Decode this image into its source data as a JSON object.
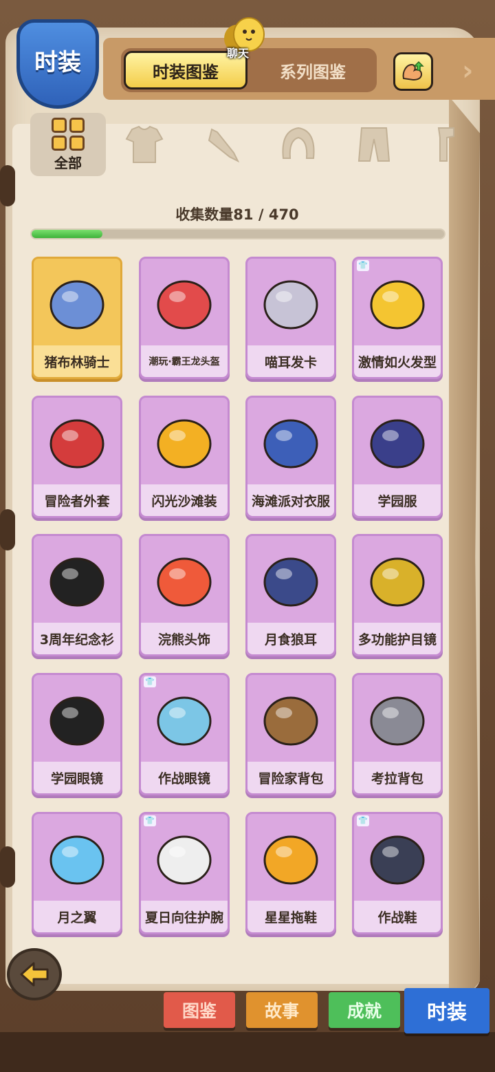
{
  "header": {
    "badge_label": "时装",
    "tabs": [
      {
        "label": "时装图鉴",
        "active": true
      },
      {
        "label": "系列图鉴",
        "active": false
      }
    ],
    "chat_label": "聊天"
  },
  "categories": [
    {
      "label": "全部",
      "icon": "grid-icon",
      "active": true
    },
    {
      "label": "",
      "icon": "top-clothes-icon"
    },
    {
      "label": "",
      "icon": "weapon-icon"
    },
    {
      "label": "",
      "icon": "hair-icon"
    },
    {
      "label": "",
      "icon": "pants-icon"
    },
    {
      "label": "",
      "icon": "accessory-icon"
    }
  ],
  "progress": {
    "label": "收集数量81 / 470",
    "collected": 81,
    "total": 470,
    "fraction": 0.172
  },
  "items": [
    {
      "name": "猪布林骑士",
      "rarity": "gold",
      "badge": false
    },
    {
      "name": "潮玩·霸王龙头盔",
      "rarity": "purple",
      "badge": false
    },
    {
      "name": "喵耳发卡",
      "rarity": "purple",
      "badge": false
    },
    {
      "name": "激情如火发型",
      "rarity": "purple",
      "badge": true
    },
    {
      "name": "冒险者外套",
      "rarity": "purple",
      "badge": false
    },
    {
      "name": "闪光沙滩装",
      "rarity": "purple",
      "badge": false
    },
    {
      "name": "海滩派对衣服",
      "rarity": "purple",
      "badge": false
    },
    {
      "name": "学园服",
      "rarity": "purple",
      "badge": false
    },
    {
      "name": "3周年纪念衫",
      "rarity": "purple",
      "badge": false
    },
    {
      "name": "浣熊头饰",
      "rarity": "purple",
      "badge": false
    },
    {
      "name": "月食狼耳",
      "rarity": "purple",
      "badge": false
    },
    {
      "name": "多功能护目镜",
      "rarity": "purple",
      "badge": false
    },
    {
      "name": "学园眼镜",
      "rarity": "purple",
      "badge": false
    },
    {
      "name": "作战眼镜",
      "rarity": "purple",
      "badge": true
    },
    {
      "name": "冒险家背包",
      "rarity": "purple",
      "badge": false
    },
    {
      "name": "考拉背包",
      "rarity": "purple",
      "badge": false
    },
    {
      "name": "月之翼",
      "rarity": "purple",
      "badge": false
    },
    {
      "name": "夏日向往护腕",
      "rarity": "purple",
      "badge": true
    },
    {
      "name": "星星拖鞋",
      "rarity": "purple",
      "badge": false
    },
    {
      "name": "作战鞋",
      "rarity": "purple",
      "badge": true
    }
  ],
  "bottom_tabs": [
    {
      "label": "图鉴"
    },
    {
      "label": "故事"
    },
    {
      "label": "成就"
    },
    {
      "label": "时装",
      "active": true
    }
  ],
  "colors": {
    "card_purple": "#dba8e0",
    "card_gold": "#f3c65a",
    "progress_green": "#3fb23a",
    "tab_gold": "#f3cd4a",
    "shield_blue": "#2f62b9"
  }
}
